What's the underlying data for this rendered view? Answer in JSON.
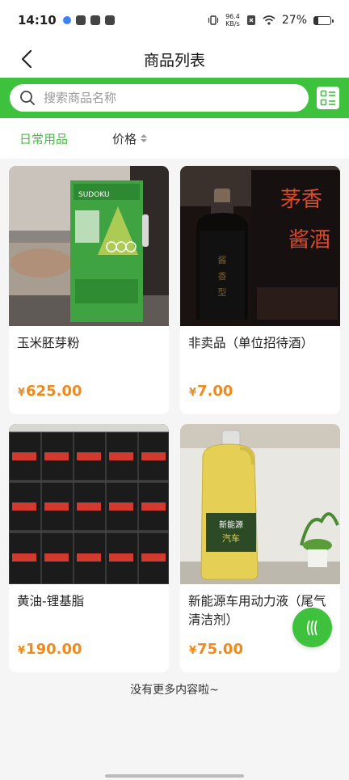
{
  "status_bar": {
    "time": "14:10",
    "net_speed_value": "96.4",
    "net_speed_unit": "KB/s",
    "battery": "27%"
  },
  "nav": {
    "title": "商品列表",
    "back_icon": "chevron-left-icon"
  },
  "search": {
    "placeholder": "搜索商品名称",
    "icon": "search-icon",
    "layout_toggle_icon": "list-layout-icon"
  },
  "filters": {
    "tabs": [
      {
        "label": "日常用品",
        "active": true
      },
      {
        "label": "价格",
        "active": false
      }
    ]
  },
  "products": [
    {
      "name": "玉米胚芽粉",
      "currency": "¥",
      "price": "625.00",
      "image": "corn-germ-powder-package"
    },
    {
      "name": "非卖品（单位招待酒）",
      "currency": "¥",
      "price": "7.00",
      "image": "maotai-liquor-bottle-and-box"
    },
    {
      "name": "黄油-锂基脂",
      "currency": "¥",
      "price": "190.00",
      "image": "stacked-grease-buckets"
    },
    {
      "name": "新能源车用动力液（尾气清洁剂）",
      "currency": "¥",
      "price": "75.00",
      "image": "yellow-fluid-jug"
    }
  ],
  "footer": {
    "no_more_text": "没有更多内容啦~"
  },
  "floating_button": {
    "icon": "waves-icon"
  },
  "colors": {
    "accent": "#3ec13c",
    "price": "#f08a1c",
    "background": "#f5f5f5"
  }
}
